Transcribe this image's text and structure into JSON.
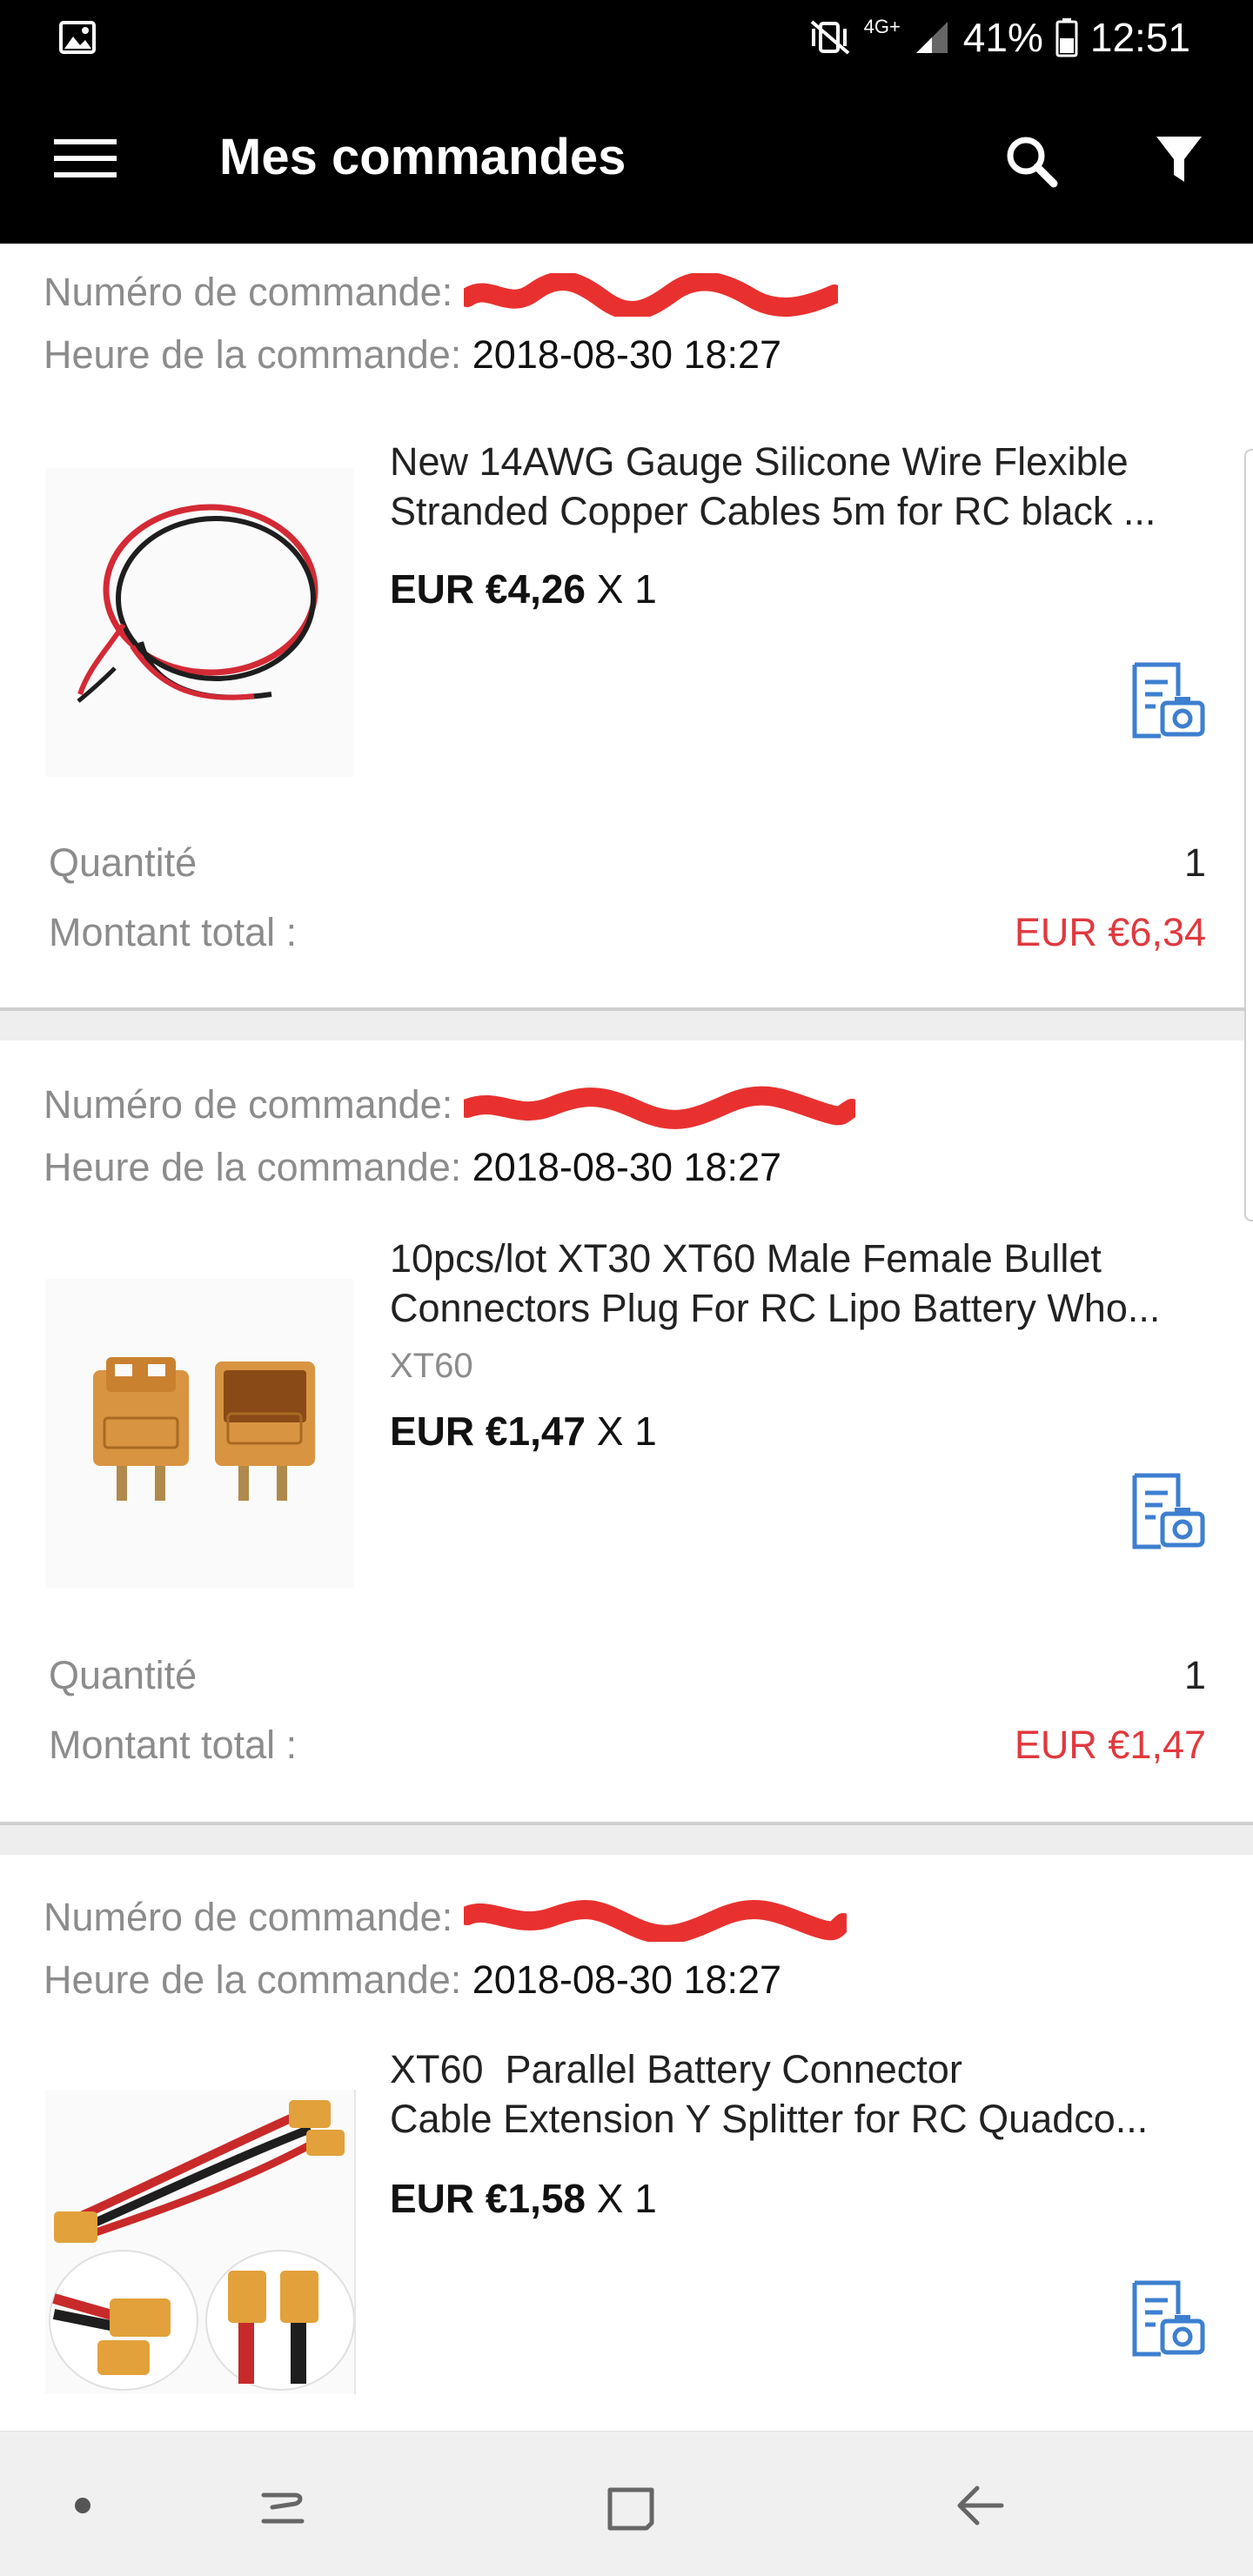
{
  "status_bar": {
    "battery": "41%",
    "time": "12:51",
    "network": "4G+"
  },
  "app_bar": {
    "title": "Mes commandes"
  },
  "labels": {
    "order_number": "Numéro de commande:",
    "order_time": "Heure de la commande:",
    "quantity": "Quantité",
    "total": "Montant total :"
  },
  "orders": [
    {
      "order_number_tail": "",
      "order_time": "2018-08-30 18:27",
      "product_title_line1": "New 14AWG Gauge Silicone Wire Flexible",
      "product_title_line2": "Stranded Copper Cables 5m for RC black ...",
      "variant": "",
      "price": "EUR €4,26",
      "multiplier": "X 1",
      "quantity": "1",
      "total": "EUR €6,34"
    },
    {
      "order_number_tail": "",
      "order_time": "2018-08-30 18:27",
      "product_title_line1": "10pcs/lot XT30 XT60 Male Female Bullet",
      "product_title_line2": "Connectors Plug For RC Lipo Battery Who...",
      "variant": "XT60",
      "price": "EUR €1,47",
      "multiplier": "X 1",
      "quantity": "1",
      "total": "EUR €1,47"
    },
    {
      "order_number_tail": "",
      "order_time": "2018-08-30 18:27",
      "product_title_line1": "XT60  Parallel Battery Connector",
      "product_title_line2": "Cable Extension Y Splitter for RC Quadco...",
      "variant": "",
      "price": "EUR €1,58",
      "multiplier": "X 1",
      "quantity": "",
      "total": ""
    }
  ],
  "icons": {
    "menu": "hamburger-menu-icon",
    "search": "search-icon",
    "filter": "filter-icon",
    "invoice": "invoice-camera-icon",
    "nav_dot": "dot-icon",
    "nav_recents": "recents-icon",
    "nav_home": "home-icon",
    "nav_back": "back-icon"
  },
  "colors": {
    "app_bar": "#000000",
    "accent_blue": "#3d7fd0",
    "total_red": "#e0393e",
    "label_gray": "#8c8c8c"
  }
}
